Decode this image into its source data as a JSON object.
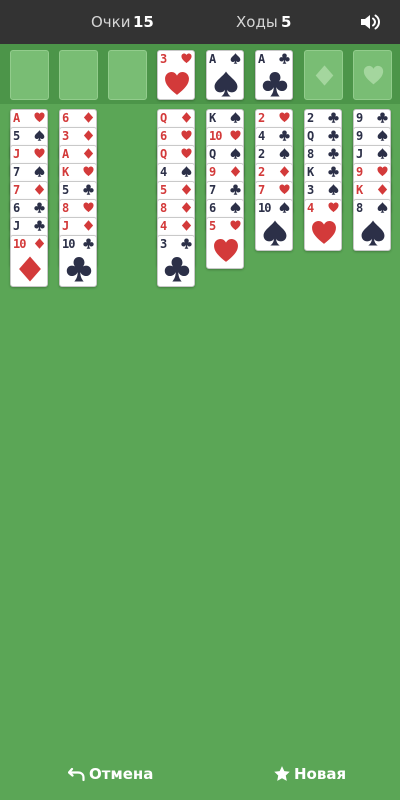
{
  "header": {
    "score_label": "Очки",
    "score_value": "15",
    "moves_label": "Ходы",
    "moves_value": "5",
    "sound_icon": "speaker-volume-icon"
  },
  "colors": {
    "table": "#5ba656",
    "topbar": "#333333",
    "red_suit": "#d33a3a",
    "black_suit": "#2c3048",
    "empty_slot": "#79bd74"
  },
  "freecells": [
    {
      "card": null
    },
    {
      "card": null
    },
    {
      "card": null
    },
    {
      "card": {
        "rank": "3",
        "suit": "hearts"
      }
    }
  ],
  "foundations": [
    {
      "card": {
        "rank": "A",
        "suit": "spades"
      }
    },
    {
      "card": {
        "rank": "A",
        "suit": "clubs"
      }
    },
    {
      "card": null,
      "placeholder_suit": "diamonds"
    },
    {
      "card": null,
      "placeholder_suit": "hearts"
    }
  ],
  "tableau": [
    [
      {
        "rank": "A",
        "suit": "hearts"
      },
      {
        "rank": "5",
        "suit": "spades"
      },
      {
        "rank": "J",
        "suit": "hearts"
      },
      {
        "rank": "7",
        "suit": "spades"
      },
      {
        "rank": "7",
        "suit": "diamonds"
      },
      {
        "rank": "6",
        "suit": "clubs"
      },
      {
        "rank": "J",
        "suit": "clubs"
      },
      {
        "rank": "10",
        "suit": "diamonds"
      }
    ],
    [
      {
        "rank": "6",
        "suit": "diamonds"
      },
      {
        "rank": "3",
        "suit": "diamonds"
      },
      {
        "rank": "A",
        "suit": "diamonds"
      },
      {
        "rank": "K",
        "suit": "hearts"
      },
      {
        "rank": "5",
        "suit": "clubs"
      },
      {
        "rank": "8",
        "suit": "hearts"
      },
      {
        "rank": "J",
        "suit": "diamonds"
      },
      {
        "rank": "10",
        "suit": "clubs"
      }
    ],
    [],
    [
      {
        "rank": "Q",
        "suit": "diamonds"
      },
      {
        "rank": "6",
        "suit": "hearts"
      },
      {
        "rank": "Q",
        "suit": "hearts"
      },
      {
        "rank": "4",
        "suit": "spades"
      },
      {
        "rank": "5",
        "suit": "diamonds"
      },
      {
        "rank": "8",
        "suit": "diamonds"
      },
      {
        "rank": "4",
        "suit": "diamonds"
      },
      {
        "rank": "3",
        "suit": "clubs"
      }
    ],
    [
      {
        "rank": "K",
        "suit": "spades"
      },
      {
        "rank": "10",
        "suit": "hearts"
      },
      {
        "rank": "Q",
        "suit": "spades"
      },
      {
        "rank": "9",
        "suit": "diamonds"
      },
      {
        "rank": "7",
        "suit": "clubs"
      },
      {
        "rank": "6",
        "suit": "spades"
      },
      {
        "rank": "5",
        "suit": "hearts"
      }
    ],
    [
      {
        "rank": "2",
        "suit": "hearts"
      },
      {
        "rank": "4",
        "suit": "clubs"
      },
      {
        "rank": "2",
        "suit": "spades"
      },
      {
        "rank": "2",
        "suit": "diamonds"
      },
      {
        "rank": "7",
        "suit": "hearts"
      },
      {
        "rank": "10",
        "suit": "spades"
      }
    ],
    [
      {
        "rank": "2",
        "suit": "clubs"
      },
      {
        "rank": "Q",
        "suit": "clubs"
      },
      {
        "rank": "8",
        "suit": "clubs"
      },
      {
        "rank": "K",
        "suit": "clubs"
      },
      {
        "rank": "3",
        "suit": "spades"
      },
      {
        "rank": "4",
        "suit": "hearts"
      }
    ],
    [
      {
        "rank": "9",
        "suit": "clubs"
      },
      {
        "rank": "9",
        "suit": "spades"
      },
      {
        "rank": "J",
        "suit": "spades"
      },
      {
        "rank": "9",
        "suit": "hearts"
      },
      {
        "rank": "K",
        "suit": "diamonds"
      },
      {
        "rank": "8",
        "suit": "spades"
      }
    ]
  ],
  "footer": {
    "undo_label": "Отмена",
    "undo_icon": "undo-arrow-icon",
    "new_label": "Новая",
    "new_icon": "star-icon"
  }
}
